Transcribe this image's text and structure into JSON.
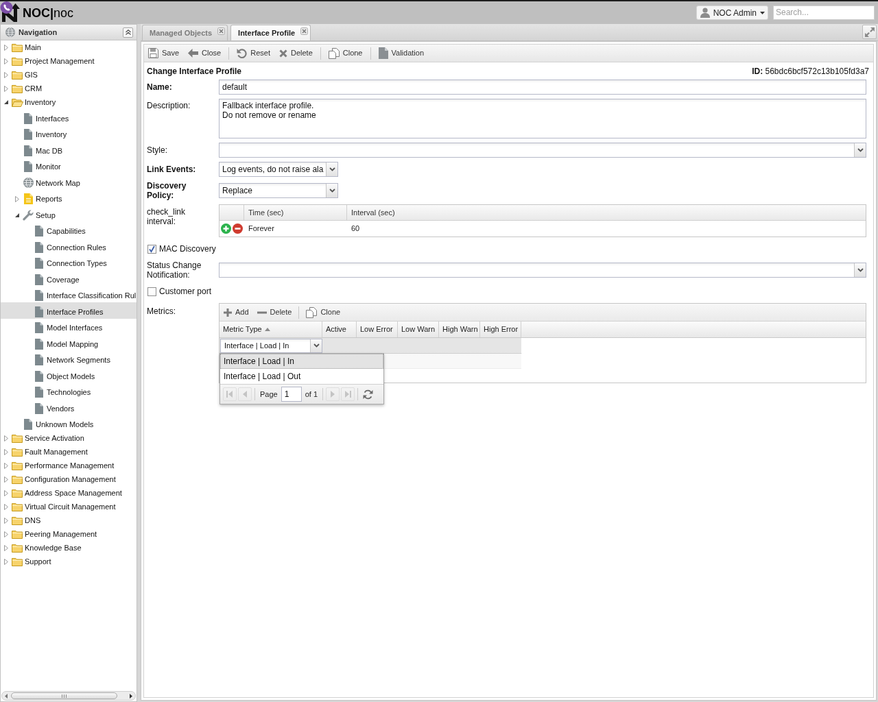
{
  "header": {
    "logo": "**NOC|**noc",
    "user_menu": "NOC Admin",
    "search_placeholder": "Search..."
  },
  "navigation": {
    "title": "Navigation",
    "tree": [
      {
        "label": "Main",
        "kind": "folder",
        "expanded": false,
        "selected": false
      },
      {
        "label": "Project Management",
        "kind": "folder",
        "expanded": false,
        "selected": false
      },
      {
        "label": "GIS",
        "kind": "folder",
        "expanded": false,
        "selected": false
      },
      {
        "label": "CRM",
        "kind": "folder",
        "expanded": false,
        "selected": false
      },
      {
        "label": "Inventory",
        "kind": "folder",
        "expanded": true,
        "selected": false,
        "children": [
          {
            "label": "Interfaces",
            "kind": "page",
            "selected": false
          },
          {
            "label": "Inventory",
            "kind": "page",
            "selected": false
          },
          {
            "label": "Mac DB",
            "kind": "page",
            "selected": false
          },
          {
            "label": "Monitor",
            "kind": "page",
            "selected": false
          },
          {
            "label": "Network Map",
            "kind": "map",
            "selected": false
          },
          {
            "label": "Reports",
            "kind": "report",
            "expanded": false,
            "selected": false
          },
          {
            "label": "Setup",
            "kind": "setup",
            "expanded": true,
            "selected": false,
            "children": [
              {
                "label": "Capabilities",
                "kind": "page",
                "selected": false
              },
              {
                "label": "Connection Rules",
                "kind": "page",
                "selected": false
              },
              {
                "label": "Connection Types",
                "kind": "page",
                "selected": false
              },
              {
                "label": "Coverage",
                "kind": "page",
                "selected": false
              },
              {
                "label": "Interface Classification Rul",
                "kind": "page",
                "selected": false
              },
              {
                "label": "Interface Profiles",
                "kind": "page",
                "selected": true
              },
              {
                "label": "Model Interfaces",
                "kind": "page",
                "selected": false
              },
              {
                "label": "Model Mapping",
                "kind": "page",
                "selected": false
              },
              {
                "label": "Network Segments",
                "kind": "page",
                "selected": false
              },
              {
                "label": "Object Models",
                "kind": "page",
                "selected": false
              },
              {
                "label": "Technologies",
                "kind": "page",
                "selected": false
              },
              {
                "label": "Vendors",
                "kind": "page",
                "selected": false
              }
            ]
          },
          {
            "label": "Unknown Models",
            "kind": "page",
            "selected": false
          }
        ]
      },
      {
        "label": "Service Activation",
        "kind": "folder",
        "expanded": false,
        "selected": false
      },
      {
        "label": "Fault Management",
        "kind": "folder",
        "expanded": false,
        "selected": false
      },
      {
        "label": "Performance Management",
        "kind": "folder",
        "expanded": false,
        "selected": false
      },
      {
        "label": "Configuration Management",
        "kind": "folder",
        "expanded": false,
        "selected": false
      },
      {
        "label": "Address Space Management",
        "kind": "folder",
        "expanded": false,
        "selected": false
      },
      {
        "label": "Virtual Circuit Management",
        "kind": "folder",
        "expanded": false,
        "selected": false
      },
      {
        "label": "DNS",
        "kind": "folder",
        "expanded": false,
        "selected": false
      },
      {
        "label": "Peering Management",
        "kind": "folder",
        "expanded": false,
        "selected": false
      },
      {
        "label": "Knowledge Base",
        "kind": "folder",
        "expanded": false,
        "selected": false
      },
      {
        "label": "Support",
        "kind": "folder",
        "expanded": false,
        "selected": false
      }
    ]
  },
  "tabs": [
    {
      "label": "Managed Objects",
      "selected": false
    },
    {
      "label": "Interface Profile",
      "selected": true
    }
  ],
  "toolbar": [
    [
      {
        "kind": "save",
        "label": "Save"
      },
      {
        "kind": "close",
        "label": "Close"
      }
    ],
    [
      {
        "kind": "reset",
        "label": "Reset"
      },
      {
        "kind": "delete",
        "label": "Delete"
      }
    ],
    [
      {
        "kind": "clone",
        "label": "Clone"
      }
    ],
    [
      {
        "kind": "validation",
        "label": "Validation"
      }
    ]
  ],
  "form": {
    "title": "Change Interface Profile",
    "id": "**ID:** 56bdc6bcf572c13b105fd3a7",
    "fields": [
      {
        "kind": "text",
        "label": "Name:",
        "required": true,
        "value": "default"
      },
      {
        "kind": "textarea",
        "label": "Description:",
        "required": false,
        "value": "Fallback interface profile.\nDo not remove or rename"
      },
      {
        "kind": "combo",
        "label": "Style:",
        "required": false
      },
      {
        "kind": "dropdown",
        "label": "Link Events:",
        "required": true,
        "value": "Log events, do not raise ala"
      },
      {
        "kind": "dropdown",
        "label": "Discovery Policy:",
        "required": true,
        "value": "Replace"
      },
      {
        "kind": "grid",
        "label": "check_link interval:",
        "required": false,
        "columns": [
          "Time (sec)",
          "Interval (sec)"
        ],
        "rows": [
          [
            "Forever",
            "60"
          ]
        ]
      },
      {
        "kind": "checkbox",
        "label": "MAC Discovery",
        "checked": true
      },
      {
        "kind": "combo",
        "label": "Status Change Notification:",
        "required": false
      },
      {
        "kind": "checkbox",
        "label": "Customer port",
        "checked": false
      },
      {
        "kind": "metrics",
        "label": "Metrics:",
        "required": false,
        "toolbar": [
          [
            {
              "kind": "add",
              "label": "Add"
            },
            {
              "kind": "remove",
              "label": "Delete"
            }
          ],
          [
            {
              "kind": "clone",
              "label": "Clone"
            }
          ]
        ],
        "columns": [
          {
            "label": "Metric Type",
            "sorted": true
          },
          {
            "label": "Active",
            "sorted": false
          },
          {
            "label": "Low Error",
            "sorted": false
          },
          {
            "label": "Low Warn",
            "sorted": false
          },
          {
            "label": "High Warn",
            "sorted": false
          },
          {
            "label": "High Error",
            "sorted": false
          }
        ],
        "editor": {
          "value": "Interface | Load | In",
          "options": [
            {
              "label": "Interface | Load | In",
              "selected": true
            },
            {
              "label": "Interface | Load | Out",
              "selected": false
            }
          ],
          "paging": {
            "buttons": [
              {
                "kind": "first",
                "disabled": true
              },
              {
                "kind": "previous",
                "disabled": true
              },
              {
                "kind": "next",
                "disabled": true
              },
              {
                "kind": "last",
                "disabled": true
              },
              {
                "kind": "refresh",
                "disabled": false
              }
            ],
            "page_label": "Page",
            "page": "1",
            "total_label": "of 1"
          }
        }
      }
    ]
  }
}
